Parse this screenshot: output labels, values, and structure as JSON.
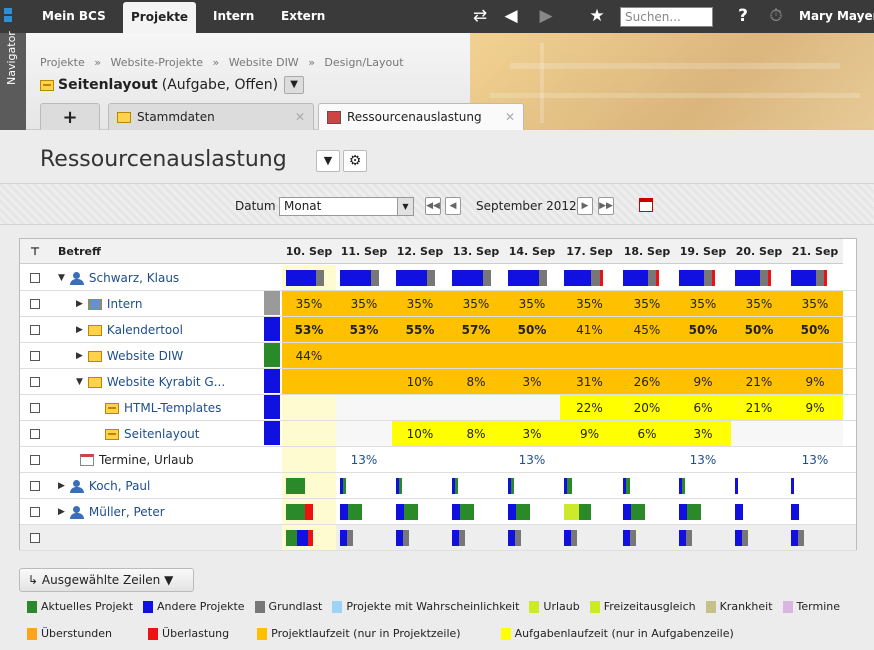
{
  "topnav": {
    "tabs": [
      "Mein BCS",
      "Projekte",
      "Intern",
      "Extern"
    ],
    "active_tab": "Projekte",
    "search_placeholder": "Suchen...",
    "help": "?",
    "user": "Mary Mayer"
  },
  "navigator_label": "Navigator",
  "breadcrumb": [
    "Projekte",
    "»",
    "Website-Projekte",
    "»",
    "Website DIW",
    "»",
    "Design/Layout"
  ],
  "task": {
    "name": "Seitenlayout",
    "meta": "(Aufgabe, Offen)"
  },
  "doc_tabs": {
    "add": "+",
    "stammdaten": "Stammdaten",
    "ressourcen": "Ressourcenauslastung"
  },
  "page_title": "Ressourcenauslastung",
  "toolbar": {
    "date_label": "Datum",
    "period": "Monat",
    "month": "September 2012"
  },
  "grid": {
    "subject_header": "Betreff",
    "days": [
      "10. Sep",
      "11. Sep",
      "12. Sep",
      "13. Sep",
      "14. Sep",
      "17. Sep",
      "18. Sep",
      "19. Sep",
      "20. Sep",
      "21. Sep"
    ],
    "rows": [
      {
        "label": "Schwarz, Klaus",
        "kind": "person",
        "marker": "",
        "values": [
          "",
          "",
          "",
          "",
          "",
          "",
          "",
          "",
          "",
          ""
        ]
      },
      {
        "label": "Intern",
        "kind": "project",
        "marker": "#9a9a9a",
        "values": [
          "35%",
          "35%",
          "35%",
          "35%",
          "35%",
          "35%",
          "35%",
          "35%",
          "35%",
          "35%"
        ]
      },
      {
        "label": "Kalendertool",
        "kind": "project",
        "marker": "#1010e0",
        "values": [
          "53%",
          "53%",
          "55%",
          "57%",
          "50%",
          "41%",
          "45%",
          "50%",
          "50%",
          "50%"
        ]
      },
      {
        "label": "Website DIW",
        "kind": "project",
        "marker": "#2a8a2a",
        "values": [
          "44%",
          "",
          "",
          "",
          "",
          "",
          "",
          "",
          "",
          ""
        ]
      },
      {
        "label": "Website Kyrabit G...",
        "kind": "project",
        "marker": "#1010e0",
        "values": [
          "",
          "",
          "10%",
          "8%",
          "3%",
          "31%",
          "26%",
          "9%",
          "21%",
          "9%"
        ]
      },
      {
        "label": "HTML-Templates",
        "kind": "task",
        "marker": "#1010e0",
        "values": [
          "",
          "",
          "",
          "",
          "",
          "22%",
          "20%",
          "6%",
          "21%",
          "9%"
        ]
      },
      {
        "label": "Seitenlayout",
        "kind": "task",
        "marker": "#1010e0",
        "values": [
          "",
          "",
          "10%",
          "8%",
          "3%",
          "9%",
          "6%",
          "3%",
          "",
          ""
        ]
      },
      {
        "label": "Termine, Urlaub",
        "kind": "calendar",
        "marker": "",
        "values": [
          "",
          "13%",
          "",
          "",
          "13%",
          "",
          "",
          "13%",
          "",
          "13%"
        ]
      },
      {
        "label": "Koch, Paul",
        "kind": "person",
        "marker": "",
        "values": [
          "",
          "",
          "",
          "",
          "",
          "",
          "",
          "",
          "",
          ""
        ]
      },
      {
        "label": "Müller, Peter",
        "kind": "person",
        "marker": "",
        "values": [
          "",
          "",
          "",
          "",
          "",
          "",
          "",
          "",
          "",
          ""
        ]
      },
      {
        "label": "",
        "kind": "total",
        "marker": "",
        "values": [
          "",
          "",
          "",
          "",
          "",
          "",
          "",
          "",
          "",
          ""
        ]
      }
    ]
  },
  "selected_rows_button": "Ausgewählte Zeilen",
  "legend": [
    {
      "label": "Aktuelles Projekt",
      "color": "#2a8a2a"
    },
    {
      "label": "Andere Projekte",
      "color": "#1010e0"
    },
    {
      "label": "Grundlast",
      "color": "#777777"
    },
    {
      "label": "Projekte mit Wahrscheinlichkeit",
      "color": "#9dd3f5"
    },
    {
      "label": "Urlaub",
      "color": "#ccea2a"
    },
    {
      "label": "Freizeitausgleich",
      "color": "#ccea2a"
    },
    {
      "label": "Krankheit",
      "color": "#c6c08a"
    },
    {
      "label": "Termine",
      "color": "#d9b6e0"
    },
    {
      "label": "Überstunden",
      "color": "#ffa31a"
    },
    {
      "label": "Überlastung",
      "color": "#ee1111"
    },
    {
      "label": "Projektlaufzeit (nur in Projektzeile)",
      "color": "#ffc000"
    },
    {
      "label": "Aufgabenlaufzeit (nur in Aufgabenzeile)",
      "color": "#ffff00"
    }
  ]
}
